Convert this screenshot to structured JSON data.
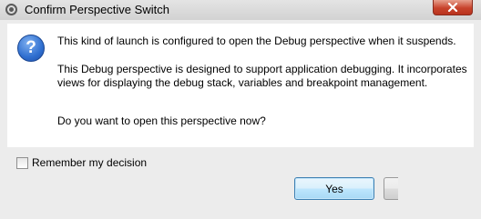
{
  "window": {
    "title": "Confirm Perspective Switch",
    "title_icon": "eclipse-icon",
    "close_icon": "close-icon"
  },
  "dialog": {
    "icon": "question-icon",
    "icon_glyph": "?",
    "message_1": "This kind of launch is configured to open the Debug perspective when it suspends.",
    "message_2": "This Debug perspective is designed to support application debugging.  It incorporates views for displaying the debug stack, variables and breakpoint management.",
    "message_3": "Do you want to open this perspective now?"
  },
  "options": {
    "remember_label": "Remember my decision",
    "remember_checked": false
  },
  "buttons": {
    "yes_label": "Yes",
    "no_label": ""
  },
  "colors": {
    "close_button": "#c8442c",
    "default_button_border": "#3c7fb1",
    "question_icon": "#2f6fd0"
  }
}
